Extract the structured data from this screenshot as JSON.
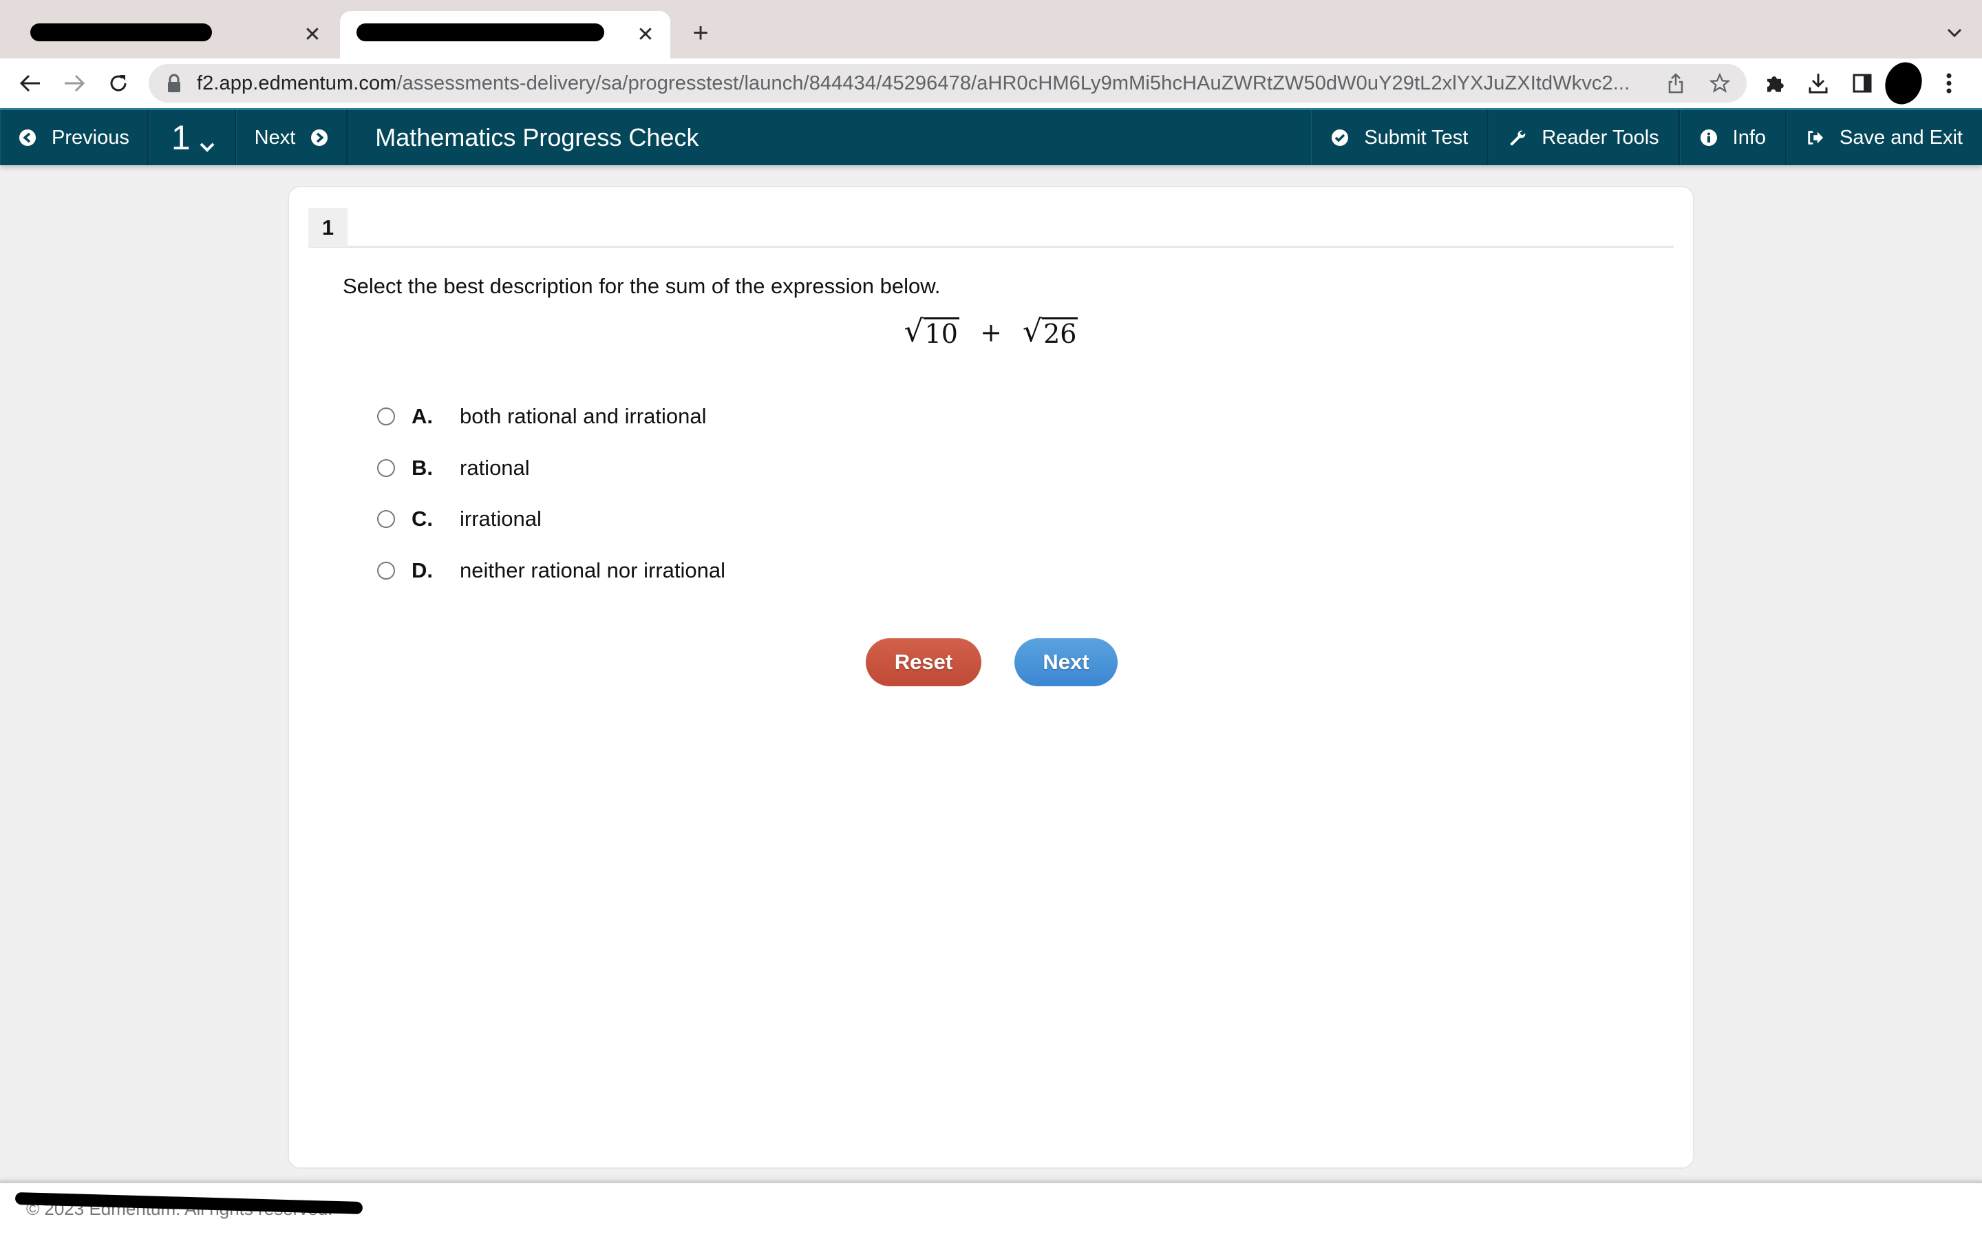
{
  "browser": {
    "tabs": [
      {
        "title": "",
        "redacted": true,
        "active": false,
        "close_icon": "close-icon"
      },
      {
        "title": "Mathematics Progress Check",
        "redacted": true,
        "active": true,
        "close_icon": "close-icon"
      }
    ],
    "new_tab_icon": "plus-icon",
    "tab_list_icon": "chevron-down-icon",
    "url_host": "f2.app.edmentum.com",
    "url_path": "/assessments-delivery/sa/progresstest/launch/844434/45296478/aHR0cHM6Ly9mMi5hcHAuZWRtZW50dW0uY29tL2xlYXJuZXItdWkvc2...",
    "toolbar_icons": [
      "back-arrow-icon",
      "forward-arrow-icon",
      "reload-icon",
      "lock-icon",
      "share-icon",
      "star-icon",
      "extensions-puzzle-icon",
      "download-icon",
      "side-panel-icon",
      "profile-avatar",
      "more-vert-icon"
    ]
  },
  "navbar": {
    "previous_label": "Previous",
    "question_number": "1",
    "next_label": "Next",
    "title": "Mathematics Progress Check",
    "submit_label": "Submit Test",
    "reader_tools_label": "Reader Tools",
    "info_label": "Info",
    "save_exit_label": "Save and Exit",
    "bar_color": "#05475a"
  },
  "question": {
    "number": "1",
    "prompt": "Select the best description for the sum of the expression below.",
    "expression": {
      "term1_radicand": "10",
      "operator": "+",
      "term2_radicand": "26",
      "radical_symbol": "√"
    },
    "options": [
      {
        "letter": "A.",
        "text": "both rational and irrational",
        "selected": false
      },
      {
        "letter": "B.",
        "text": "rational",
        "selected": false
      },
      {
        "letter": "C.",
        "text": "irrational",
        "selected": false
      },
      {
        "letter": "D.",
        "text": "neither rational nor irrational",
        "selected": false
      }
    ],
    "reset_label": "Reset",
    "next_label": "Next",
    "reset_color": "#c8533e",
    "next_color": "#4a93d8"
  },
  "footer": {
    "copyright": "© 2023 Edmentum. All rights reserved.",
    "redacted": true
  }
}
